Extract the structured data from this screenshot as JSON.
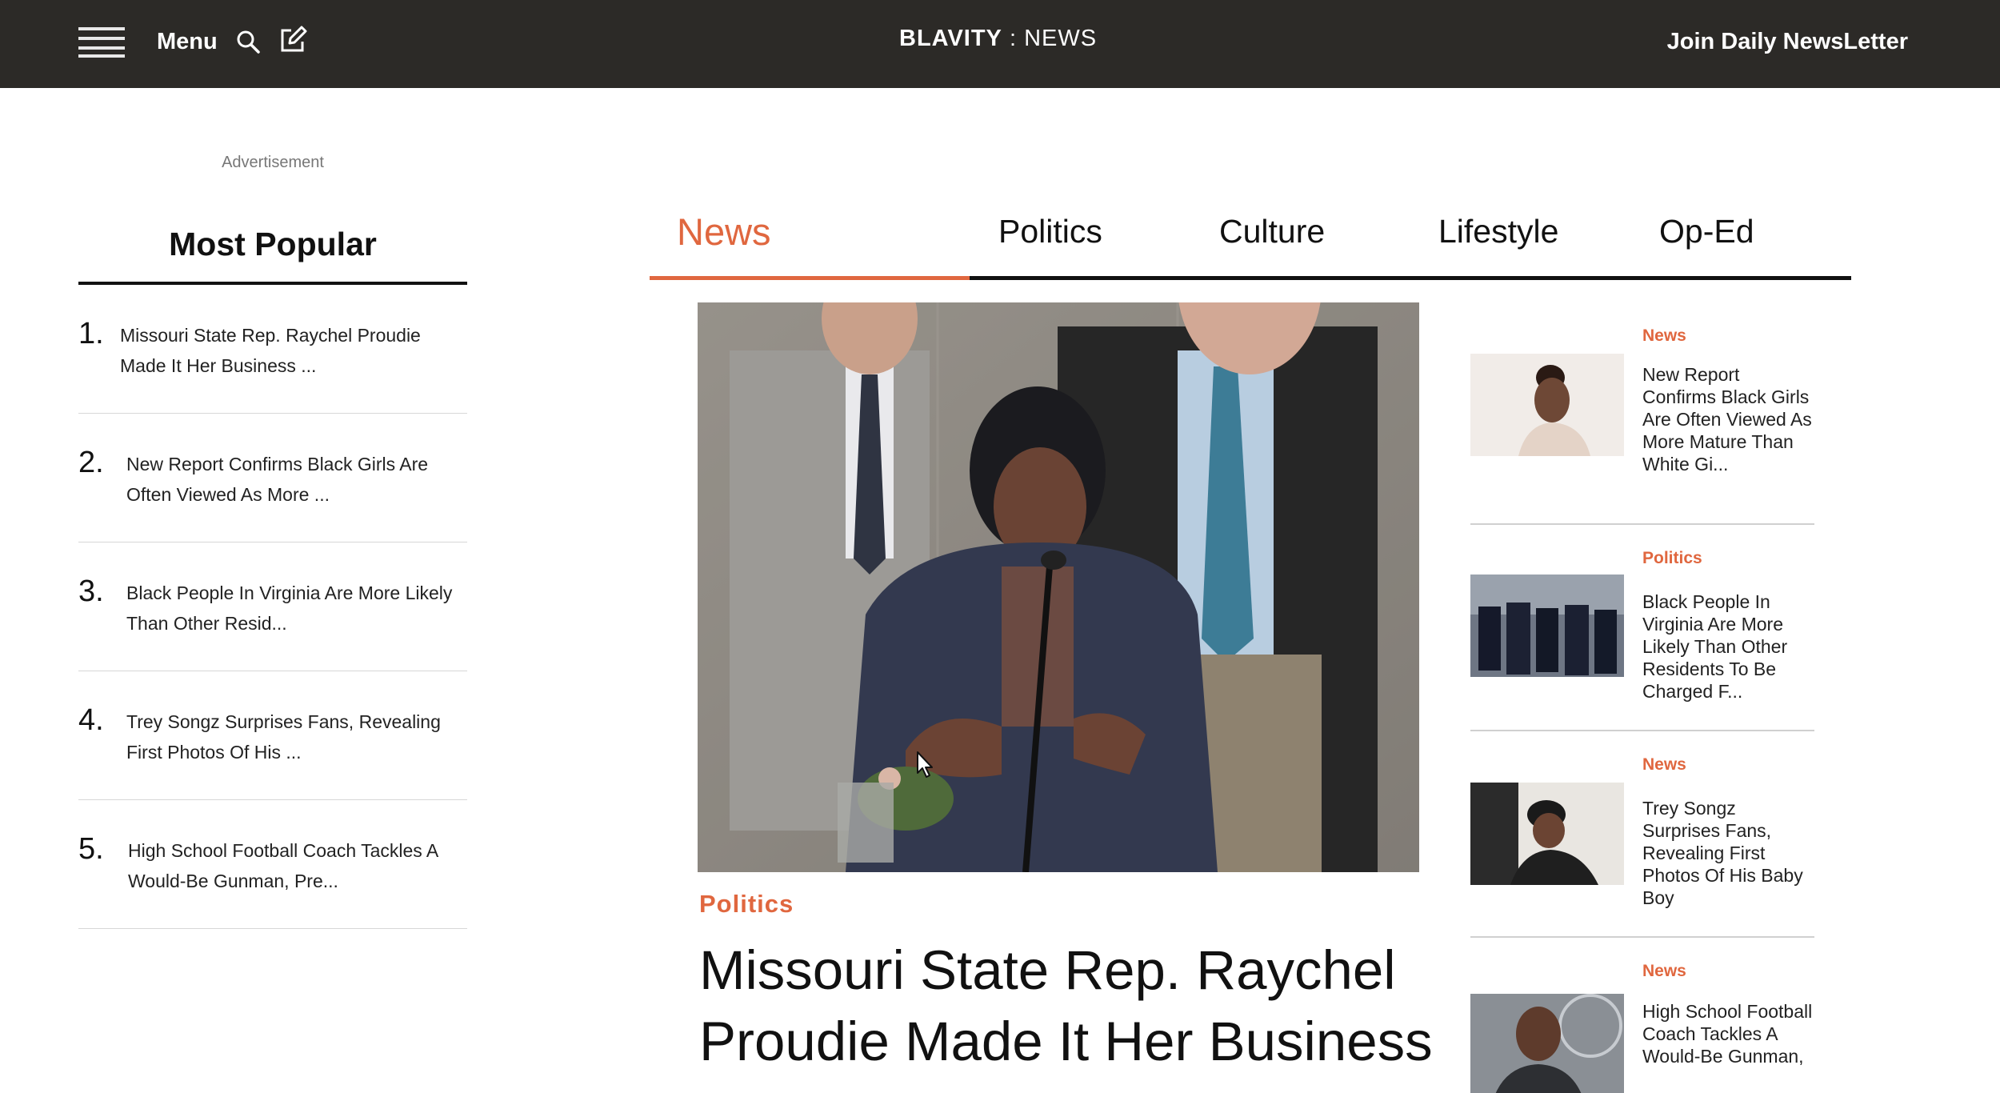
{
  "header": {
    "menu_label": "Menu",
    "brand_primary": "BLAVITY",
    "brand_separator": ":",
    "brand_secondary": "NEWS",
    "join_label": "Join Daily NewsLetter"
  },
  "sidebar": {
    "advertisement_label": "Advertisement",
    "most_popular_title": "Most Popular",
    "items": [
      {
        "num": "1.",
        "text": "Missouri State Rep. Raychel Proudie Made It Her Business ..."
      },
      {
        "num": "2.",
        "text": "New Report Confirms Black Girls Are Often Viewed As More ..."
      },
      {
        "num": "3.",
        "text": "Black People In Virginia Are More Likely Than Other Resid..."
      },
      {
        "num": "4.",
        "text": "Trey Songz Surprises Fans, Revealing First Photos Of His ..."
      },
      {
        "num": "5.",
        "text": "High School Football Coach Tackles A Would-Be Gunman, Pre..."
      }
    ]
  },
  "tabs": [
    "News",
    "Politics",
    "Culture",
    "Lifestyle",
    "Op-Ed"
  ],
  "active_tab": "News",
  "hero": {
    "category": "Politics",
    "title": "Missouri State Rep. Raychel Proudie Made It Her Business"
  },
  "rail": [
    {
      "category": "News",
      "text": "New Report Confirms Black Girls Are Often Viewed As More Mature Than White Gi..."
    },
    {
      "category": "Politics",
      "text": "Black People In Virginia Are More Likely Than Other Residents To Be Charged F..."
    },
    {
      "category": "News",
      "text": "Trey Songz Surprises Fans, Revealing First Photos Of His Baby Boy"
    },
    {
      "category": "News",
      "text": "High School Football Coach Tackles A Would-Be Gunman,"
    }
  ],
  "colors": {
    "topbar": "#2c2a27",
    "accent": "#e0673f"
  }
}
